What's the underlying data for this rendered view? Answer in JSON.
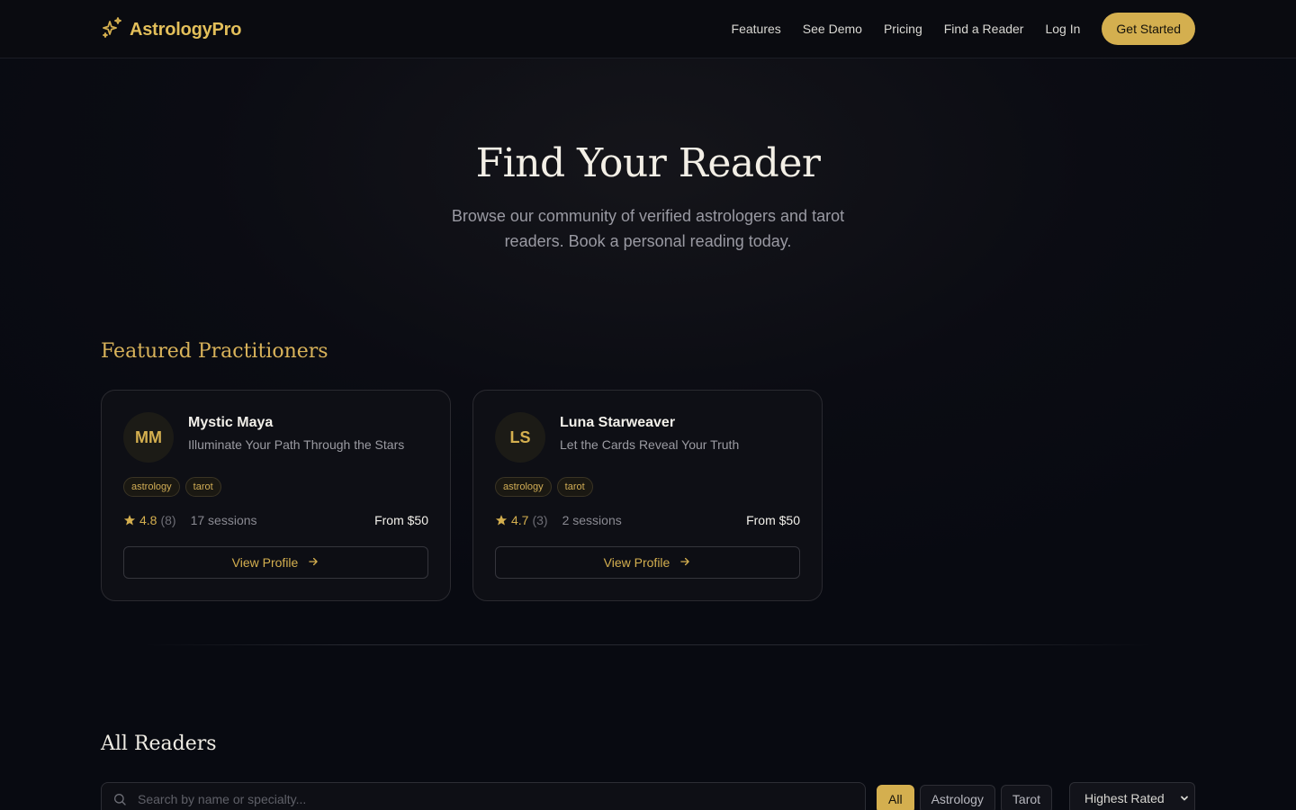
{
  "nav": {
    "brand": "AstrologyPro",
    "links": [
      "Features",
      "See Demo",
      "Pricing",
      "Find a Reader",
      "Log In"
    ],
    "cta": "Get Started"
  },
  "hero": {
    "title": "Find Your Reader",
    "subtitle": "Browse our community of verified astrologers and tarot readers. Book a personal reading today."
  },
  "featured": {
    "title": "Featured Practitioners",
    "cards": [
      {
        "initials": "MM",
        "name": "Mystic Maya",
        "tagline": "Illuminate Your Path Through the Stars",
        "tags": [
          "astrology",
          "tarot"
        ],
        "rating": "4.8",
        "reviews": "(8)",
        "sessions": "17 sessions",
        "price": "From $50",
        "button": "View Profile"
      },
      {
        "initials": "LS",
        "name": "Luna Starweaver",
        "tagline": "Let the Cards Reveal Your Truth",
        "tags": [
          "astrology",
          "tarot"
        ],
        "rating": "4.7",
        "reviews": "(3)",
        "sessions": "2 sessions",
        "price": "From $50",
        "button": "View Profile"
      }
    ]
  },
  "all_readers": {
    "title": "All Readers",
    "search_placeholder": "Search by name or specialty...",
    "filters": [
      "All",
      "Astrology",
      "Tarot"
    ],
    "active_filter": "All",
    "sort_value": "Highest Rated"
  },
  "colors": {
    "accent": "#d4af4f",
    "background": "#080a11",
    "card": "#0e0f15"
  },
  "icons": {
    "brand": "sparkles-icon",
    "rating": "star-icon",
    "button": "arrow-right-icon",
    "search": "search-icon",
    "sort": "chevron-down-icon"
  }
}
